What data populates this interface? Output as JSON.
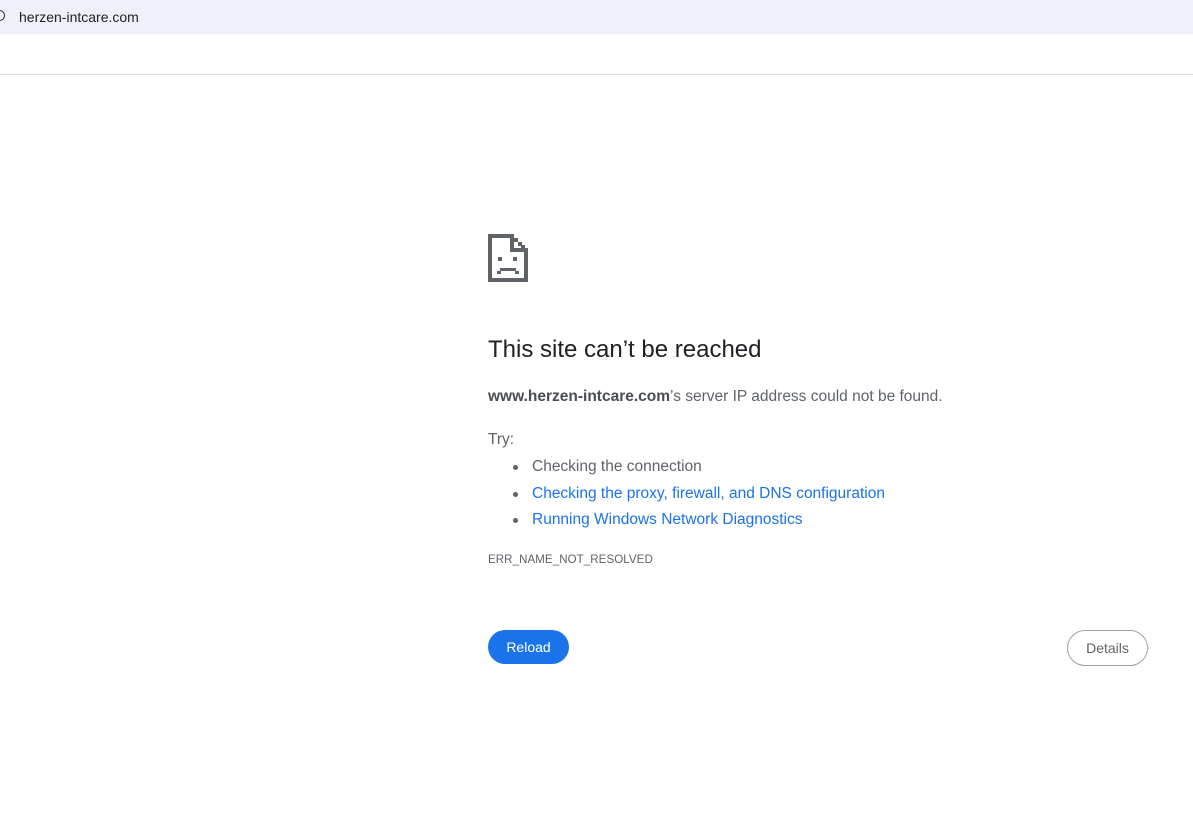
{
  "browser": {
    "url": "herzen-intcare.com",
    "site_info_icon": "info-circle-icon"
  },
  "error_page": {
    "icon": "sad-document-icon",
    "heading": "This site can’t be reached",
    "host": "www.herzen-intcare.com",
    "message_suffix": "’s server IP address could not be found.",
    "try_label": "Try:",
    "suggestions": [
      {
        "text": "Checking the connection",
        "is_link": false
      },
      {
        "text": "Checking the proxy, firewall, and DNS configuration",
        "is_link": true
      },
      {
        "text": "Running Windows Network Diagnostics",
        "is_link": true
      }
    ],
    "error_code": "ERR_NAME_NOT_RESOLVED",
    "reload_label": "Reload",
    "details_label": "Details"
  },
  "colors": {
    "accent": "#1a73e8",
    "text_secondary": "#5f6368",
    "heading": "#202124",
    "address_bar_bg": "#eef1f9"
  }
}
